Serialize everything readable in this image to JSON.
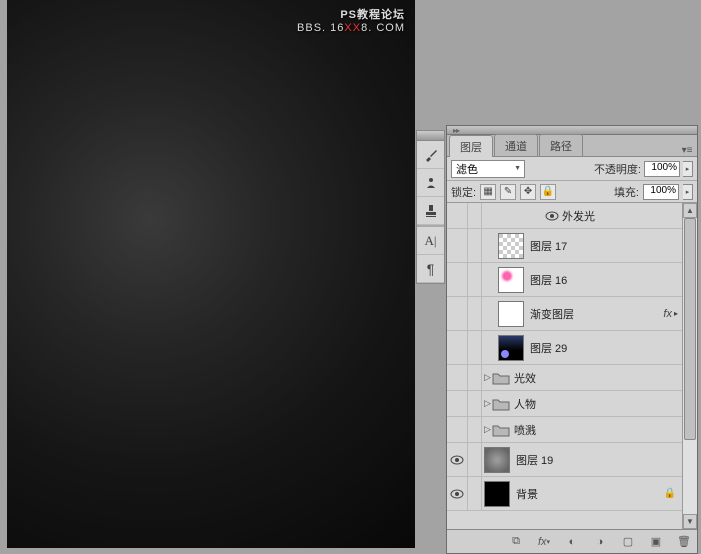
{
  "watermark": {
    "line1": "PS教程论坛",
    "line2_pre": "BBS. 16",
    "line2_xx": "XX",
    "line2_post": "8. COM"
  },
  "tabs": {
    "layers": "图层",
    "channels": "通道",
    "paths": "路径"
  },
  "options": {
    "blend_mode": "滤色",
    "opacity_label": "不透明度:",
    "opacity_value": "100%",
    "lock_label": "锁定:",
    "fill_label": "填充:",
    "fill_value": "100%"
  },
  "effects": {
    "outer_glow": "外发光",
    "fx_label": "fx"
  },
  "layers": [
    {
      "name": "图层 17"
    },
    {
      "name": "图层 16"
    },
    {
      "name": "渐变图层"
    },
    {
      "name": "图层 29"
    },
    {
      "name": "光效"
    },
    {
      "name": "人物"
    },
    {
      "name": "喷溅"
    },
    {
      "name": "图层 19"
    },
    {
      "name": "背景"
    }
  ],
  "footer_icons": [
    "link",
    "fx",
    "mask",
    "adjust",
    "folder",
    "new",
    "trash"
  ]
}
